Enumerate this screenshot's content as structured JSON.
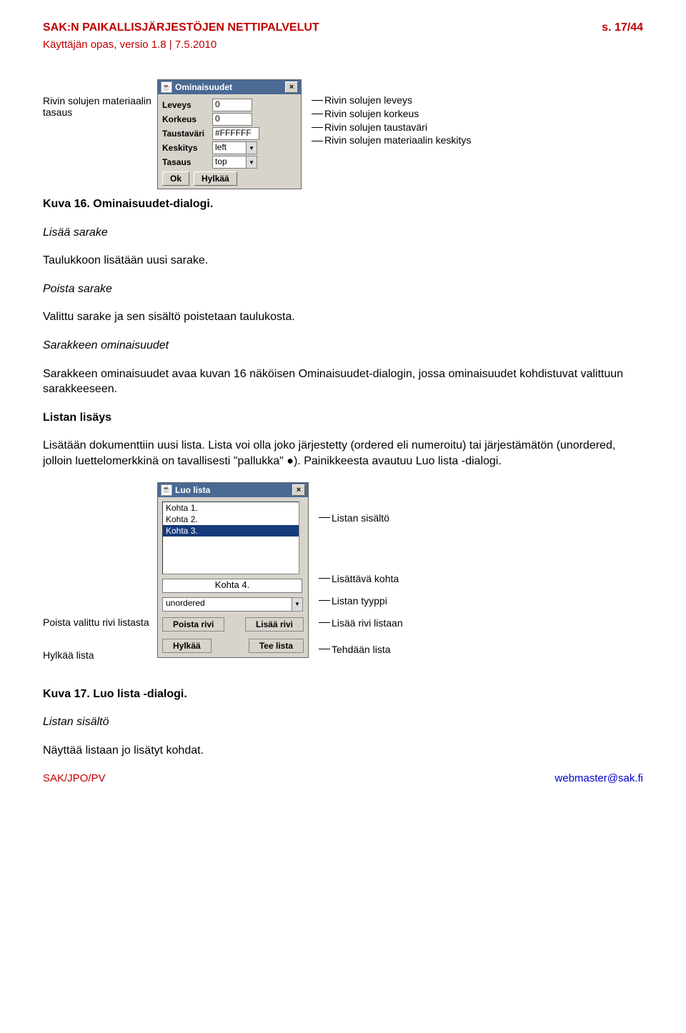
{
  "header": {
    "title": "SAK:N PAIKALLISJÄRJESTÖJEN NETTIPALVELUT",
    "subtitle": "Käyttäjän opas, versio 1.8 | 7.5.2010",
    "page": "s. 17/44"
  },
  "fig1": {
    "leftLabel": "Rivin solujen materiaalin tasaus",
    "dialogTitle": "Ominaisuudet",
    "rows": {
      "leveys": {
        "label": "Leveys",
        "value": "0"
      },
      "korkeus": {
        "label": "Korkeus",
        "value": "0"
      },
      "tausta": {
        "label": "Taustaväri",
        "value": "#FFFFFF"
      },
      "keskitys": {
        "label": "Keskitys",
        "value": "left"
      },
      "tasaus": {
        "label": "Tasaus",
        "value": "top"
      }
    },
    "okLabel": "Ok",
    "cancelLabel": "Hylkää",
    "rightLabels": {
      "r1": "Rivin solujen leveys",
      "r2": "Rivin solujen korkeus",
      "r3": "Rivin solujen taustaväri",
      "r4": "Rivin solujen materiaalin keskitys"
    }
  },
  "content": {
    "cap1": "Kuva 16. Ominaisuudet-dialogi.",
    "h1": "Lisää sarake",
    "p1": "Taulukkoon lisätään uusi sarake.",
    "h2": "Poista sarake",
    "p2": "Valittu sarake ja sen sisältö poistetaan taulukosta.",
    "h3": "Sarakkeen ominaisuudet",
    "p3": "Sarakkeen ominaisuudet avaa kuvan 16 näköisen Ominaisuudet-dialogin, jossa ominaisuudet kohdistuvat valittuun sarakkeeseen.",
    "h4": "Listan lisäys",
    "p4": "Lisätään dokumenttiin uusi lista. Lista voi olla joko järjestetty (ordered eli numeroitu) tai järjestämätön (unordered, jolloin luettelomerkkinä on tavallisesti \"pallukka\" ●). Painikkeesta avautuu Luo lista -dialogi.",
    "cap2": "Kuva 17. Luo lista -dialogi.",
    "h5": "Listan sisältö",
    "p5": "Näyttää listaan jo lisätyt kohdat."
  },
  "fig2": {
    "dialogTitle": "Luo lista",
    "items": {
      "i1": "Kohta 1.",
      "i2": "Kohta 2.",
      "i3": "Kohta 3."
    },
    "newItem": "Kohta 4.",
    "typeValue": "unordered",
    "btnPoista": "Poista rivi",
    "btnLisaa": "Lisää rivi",
    "btnHylkaa": "Hylkää",
    "btnTee": "Tee lista",
    "leftLabels": {
      "l1": "Poista valittu rivi listasta",
      "l2": "Hylkää lista"
    },
    "rightLabels": {
      "r1": "Listan sisältö",
      "r2": "Lisättävä kohta",
      "r3": "Listan tyyppi",
      "r4": "Lisää rivi listaan",
      "r5": "Tehdään lista"
    }
  },
  "footer": {
    "left": "SAK/JPO/PV",
    "right": "webmaster@sak.fi"
  }
}
